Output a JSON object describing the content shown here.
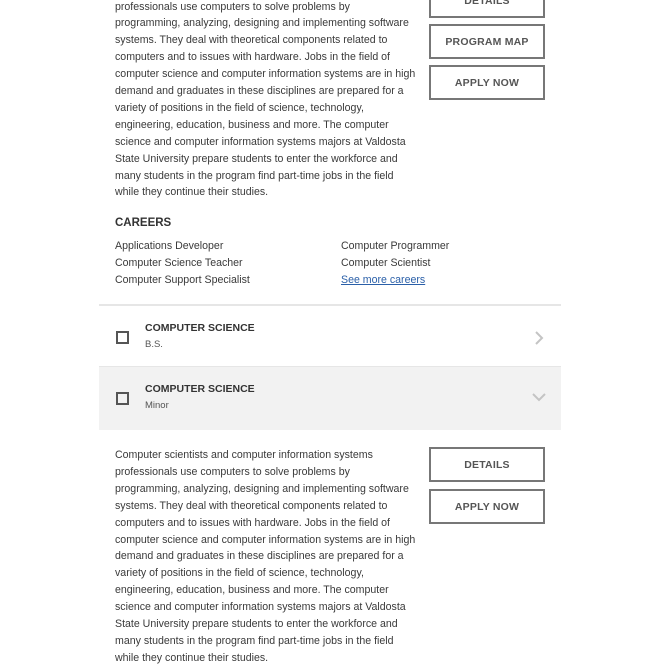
{
  "section1": {
    "paragraph_lines": [
      "professionals use computers to solve problems by",
      "programming, analyzing, designing and implementing software",
      "systems. They deal with theoretical components related to",
      "computers and to issues with hardware. Jobs in the field of",
      "computer science and computer information systems are in high",
      "demand and graduates in these disciplines are prepared for a",
      "variety of positions in the field of science, technology,",
      "engineering, education, business and more. The computer",
      "science and computer information systems majors at Valdosta",
      "State University prepare students to enter the workforce and",
      "many students in the program find part-time jobs in the field",
      "while they continue their studies."
    ],
    "buttons": {
      "details": "DETAILS",
      "program_map": "PROGRAM MAP",
      "apply_now": "APPLY NOW"
    },
    "careers_heading": "CAREERS",
    "careers": [
      "Applications Developer",
      "Computer Programmer",
      "Computer Science Teacher",
      "Computer Scientist",
      "Computer Support Specialist"
    ],
    "see_more": "See more careers"
  },
  "programs": [
    {
      "title": "COMPUTER SCIENCE",
      "degree": "B.S.",
      "icon": "chevron-right-icon",
      "expanded": false
    },
    {
      "title": "COMPUTER SCIENCE",
      "degree": "Minor",
      "icon": "chevron-down-icon",
      "expanded": true
    }
  ],
  "section2": {
    "paragraph_lines": [
      "Computer scientists and computer information systems",
      "professionals use computers to solve problems by",
      "programming, analyzing, designing and implementing software",
      "systems. They deal with theoretical components related to",
      "computers and to issues with hardware. Jobs in the field of",
      "computer science and computer information systems are in high",
      "demand and graduates in these disciplines are prepared for a",
      "variety of positions in the field of science, technology,",
      "engineering, education, business and more. The computer",
      "science and computer information systems majors at Valdosta",
      "State University prepare students to enter the workforce and",
      "many students in the program find part-time jobs in the field",
      "while they continue their studies."
    ],
    "buttons": {
      "details": "DETAILS",
      "apply_now": "APPLY NOW"
    }
  },
  "colors": {
    "expanded_row_bg": "#f2f2f2",
    "link": "#2a5fa8",
    "button_border": "#777777"
  }
}
